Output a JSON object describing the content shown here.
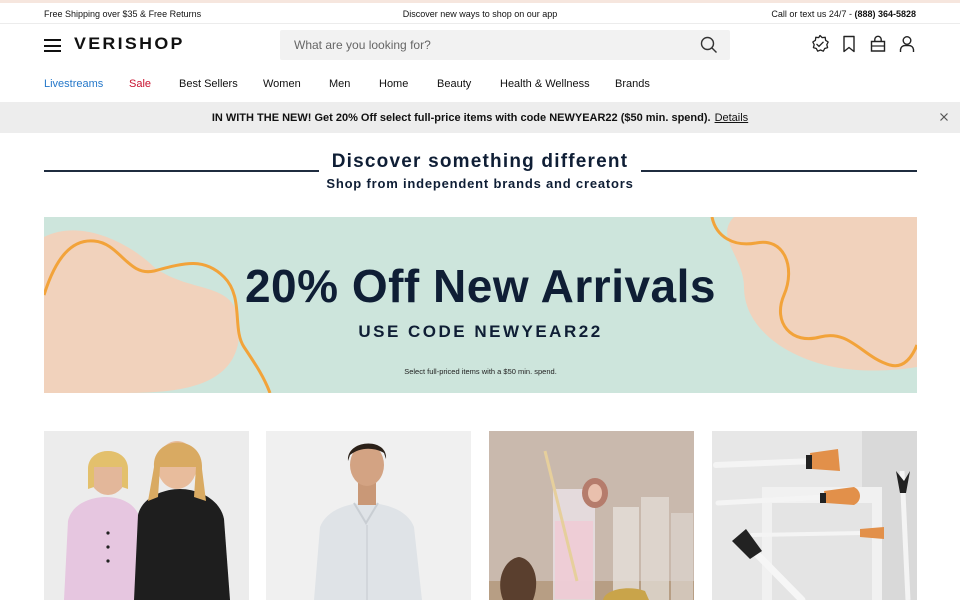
{
  "utility": {
    "left": "Free Shipping over $35 & Free Returns",
    "center": "Discover new ways to shop on our app",
    "right_prefix": "Call or text us 24/7 - ",
    "phone": "(888) 364-5828"
  },
  "header": {
    "logo": "VERISHOP",
    "search_placeholder": "What are you looking for?",
    "icons": [
      "menu-icon",
      "search-icon",
      "rewards-badge-icon",
      "bookmark-icon",
      "shopping-bag-icon",
      "account-icon"
    ]
  },
  "nav": {
    "items": [
      "Livestreams",
      "Sale",
      "Best Sellers",
      "Women",
      "Men",
      "Home",
      "Beauty",
      "Health & Wellness",
      "Brands"
    ]
  },
  "promo": {
    "text": "IN WITH THE NEW! Get 20% Off select full-price items with code NEWYEAR22 ($50 min. spend).",
    "link": "Details"
  },
  "discover": {
    "title": "Discover something different",
    "subtitle": "Shop from independent brands and creators"
  },
  "hero": {
    "title": "20% Off New Arrivals",
    "code": "USE CODE NEWYEAR22",
    "fine_print": "Select full-priced items with a $50 min. spend."
  },
  "tiles": [
    "women-category-tile",
    "men-category-tile",
    "home-category-tile",
    "beauty-category-tile"
  ],
  "colors": {
    "navy": "#0f1e35",
    "link_blue": "#2477c9",
    "sale_red": "#c8102e",
    "hero_mint": "#cde5dc",
    "hero_orange": "#f2a33a",
    "promo_gray": "#ededed"
  }
}
